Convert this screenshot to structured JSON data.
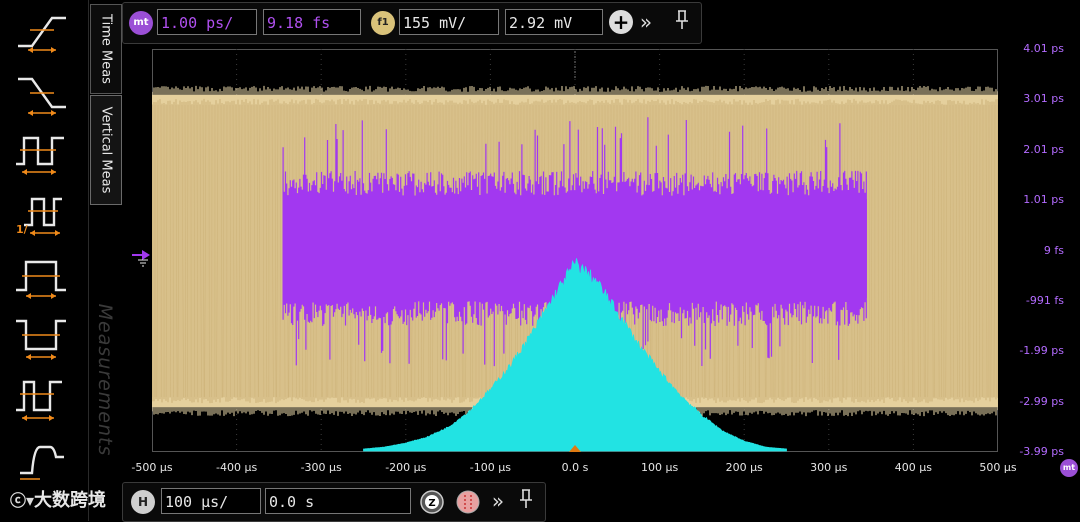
{
  "colors": {
    "eye": "#d8c08a",
    "jitter": "#a238f0",
    "histogram": "#22e3e3",
    "axis_text": "#b36bff",
    "marker": "#e07a12"
  },
  "top_bar": {
    "mt_badge": "mt",
    "scale_value": "1.00 ps/",
    "offset_value": "9.18 fs",
    "f1_badge": "f1",
    "vert_scale_value": "155 mV/",
    "vert_offset_value": "2.92 mV",
    "add_icon": "plus-icon",
    "more_icon": "double-chevron-right-icon",
    "pin_icon": "pin-icon"
  },
  "tabs": {
    "time_meas": "Time Meas",
    "vertical_meas": "Vertical Meas",
    "measurements": "Measurements"
  },
  "left_toolbar": [
    {
      "name": "rise-time-icon"
    },
    {
      "name": "fall-time-icon"
    },
    {
      "name": "period-icon"
    },
    {
      "name": "frequency-icon",
      "label": "1/"
    },
    {
      "name": "positive-width-icon"
    },
    {
      "name": "negative-width-icon"
    },
    {
      "name": "duty-cycle-icon"
    },
    {
      "name": "edge-time-icon"
    }
  ],
  "y_axis": {
    "labels": [
      "4.01 ps",
      "3.01 ps",
      "2.01 ps",
      "1.01 ps",
      "9 fs",
      "-991 fs",
      "-1.99 ps",
      "-2.99 ps",
      "-3.99 ps"
    ]
  },
  "x_axis": {
    "labels": [
      "-500 µs",
      "-400 µs",
      "-300 µs",
      "-200 µs",
      "-100 µs",
      "0.0 s",
      "100 µs",
      "200 µs",
      "300 µs",
      "400 µs",
      "500 µs"
    ],
    "end_badge": "mt"
  },
  "bottom_bar": {
    "h_badge": "H",
    "horiz_scale_value": "100 µs/",
    "horiz_position_value": "0.0 s",
    "zoom_icon": "zoom-icon",
    "acquire_icon": "acquire-icon",
    "more_icon": "double-chevron-right-icon",
    "pin_icon": "pin-icon"
  },
  "watermark": {
    "text": "大数跨境"
  },
  "chart_data": {
    "type": "area",
    "xlabel": "",
    "ylabel": "",
    "xlim": [
      -500,
      500
    ],
    "x_unit": "µs",
    "ylim": [
      -3.99,
      4.01
    ],
    "y_unit": "ps",
    "grid": true,
    "series": [
      {
        "kind": "eye-band",
        "x_range": [
          -500,
          500
        ],
        "upper_edge": 3.1,
        "lower_edge": -3.1
      },
      {
        "kind": "jitter-trend",
        "x_range": [
          -345,
          345
        ],
        "center": 0.05,
        "typical_amplitude": 1.4,
        "peak_amplitude": 2.5
      },
      {
        "kind": "histogram",
        "x": [
          -250,
          -225,
          -200,
          -175,
          -150,
          -125,
          -100,
          -75,
          -50,
          -25,
          0,
          25,
          50,
          75,
          100,
          125,
          150,
          175,
          200,
          225,
          250
        ],
        "height_fraction": [
          0.01,
          0.02,
          0.04,
          0.07,
          0.12,
          0.2,
          0.31,
          0.44,
          0.6,
          0.78,
          0.95,
          0.86,
          0.7,
          0.54,
          0.4,
          0.28,
          0.18,
          0.1,
          0.05,
          0.02,
          0.01
        ]
      }
    ]
  }
}
